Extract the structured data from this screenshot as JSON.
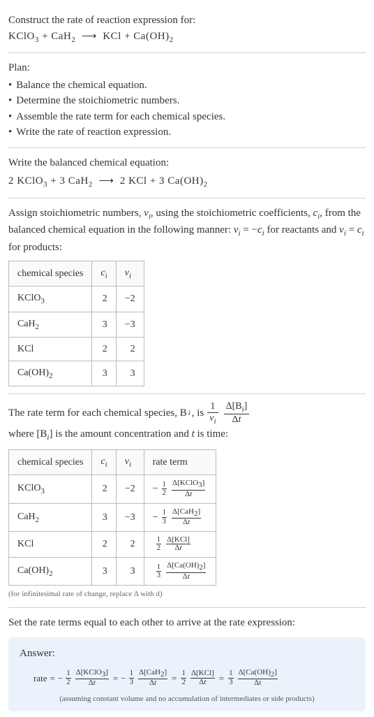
{
  "title": "Construct the rate of reaction expression for:",
  "equation_unbalanced_html": "KClO<sub>3</sub> + CaH<sub>2</sub> &nbsp;⟶&nbsp; KCl + Ca(OH)<sub>2</sub>",
  "plan_header": "Plan:",
  "plan_items": [
    "Balance the chemical equation.",
    "Determine the stoichiometric numbers.",
    "Assemble the rate term for each chemical species.",
    "Write the rate of reaction expression."
  ],
  "balanced_intro": "Write the balanced chemical equation:",
  "equation_balanced_html": "2 KClO<sub>3</sub> + 3 CaH<sub>2</sub> &nbsp;⟶&nbsp; 2 KCl + 3 Ca(OH)<sub>2</sub>",
  "stoich_intro_html": "Assign stoichiometric numbers, <i>ν<sub>i</sub></i>, using the stoichiometric coefficients, <i>c<sub>i</sub></i>, from the balanced chemical equation in the following manner: <i>ν<sub>i</sub></i> = −<i>c<sub>i</sub></i> for reactants and <i>ν<sub>i</sub></i> = <i>c<sub>i</sub></i> for products:",
  "table1": {
    "headers": [
      "chemical species",
      "cᵢ",
      "νᵢ"
    ],
    "rows": [
      {
        "species_html": "KClO<sub>3</sub>",
        "c": "2",
        "v": "−2"
      },
      {
        "species_html": "CaH<sub>2</sub>",
        "c": "3",
        "v": "−3"
      },
      {
        "species_html": "KCl",
        "c": "2",
        "v": "2"
      },
      {
        "species_html": "Ca(OH)<sub>2</sub>",
        "c": "3",
        "v": "3"
      }
    ]
  },
  "rate_intro_pre": "The rate term for each chemical species, B",
  "rate_intro_mid": ", is ",
  "rate_intro_post_html": " where [B<sub><i>i</i></sub>] is the amount concentration and <i>t</i> is time:",
  "table2": {
    "headers": [
      "chemical species",
      "cᵢ",
      "νᵢ",
      "rate term"
    ],
    "rows": [
      {
        "species_html": "KClO<sub>3</sub>",
        "c": "2",
        "v": "−2",
        "sign": "−",
        "coef_num": "1",
        "coef_den": "2",
        "delta_html": "Δ[KClO<sub>3</sub>]"
      },
      {
        "species_html": "CaH<sub>2</sub>",
        "c": "3",
        "v": "−3",
        "sign": "−",
        "coef_num": "1",
        "coef_den": "3",
        "delta_html": "Δ[CaH<sub>2</sub>]"
      },
      {
        "species_html": "KCl",
        "c": "2",
        "v": "2",
        "sign": "",
        "coef_num": "1",
        "coef_den": "2",
        "delta_html": "Δ[KCl]"
      },
      {
        "species_html": "Ca(OH)<sub>2</sub>",
        "c": "3",
        "v": "3",
        "sign": "",
        "coef_num": "1",
        "coef_den": "3",
        "delta_html": "Δ[Ca(OH)<sub>2</sub>]"
      }
    ]
  },
  "table2_note": "(for infinitesimal rate of change, replace Δ with d)",
  "final_intro": "Set the rate terms equal to each other to arrive at the rate expression:",
  "answer_label": "Answer:",
  "rate_label": "rate",
  "answer_terms": [
    {
      "sign": "−",
      "coef_num": "1",
      "coef_den": "2",
      "delta_html": "Δ[KClO<sub>3</sub>]"
    },
    {
      "sign": "−",
      "coef_num": "1",
      "coef_den": "3",
      "delta_html": "Δ[CaH<sub>2</sub>]"
    },
    {
      "sign": "",
      "coef_num": "1",
      "coef_den": "2",
      "delta_html": "Δ[KCl]"
    },
    {
      "sign": "",
      "coef_num": "1",
      "coef_den": "3",
      "delta_html": "Δ[Ca(OH)<sub>2</sub>]"
    }
  ],
  "delta_t": "Δt",
  "answer_note": "(assuming constant volume and no accumulation of intermediates or side products)",
  "chart_data": {
    "type": "table",
    "title": "Stoichiometric numbers and rate terms",
    "species": [
      "KClO3",
      "CaH2",
      "KCl",
      "Ca(OH)2"
    ],
    "c_i": [
      2,
      3,
      2,
      3
    ],
    "nu_i": [
      -2,
      -3,
      2,
      3
    ],
    "rate_coefficient": [
      -0.5,
      -0.3333,
      0.5,
      0.3333
    ],
    "rate_expression": "rate = -1/2 d[KClO3]/dt = -1/3 d[CaH2]/dt = 1/2 d[KCl]/dt = 1/3 d[Ca(OH)2]/dt"
  }
}
